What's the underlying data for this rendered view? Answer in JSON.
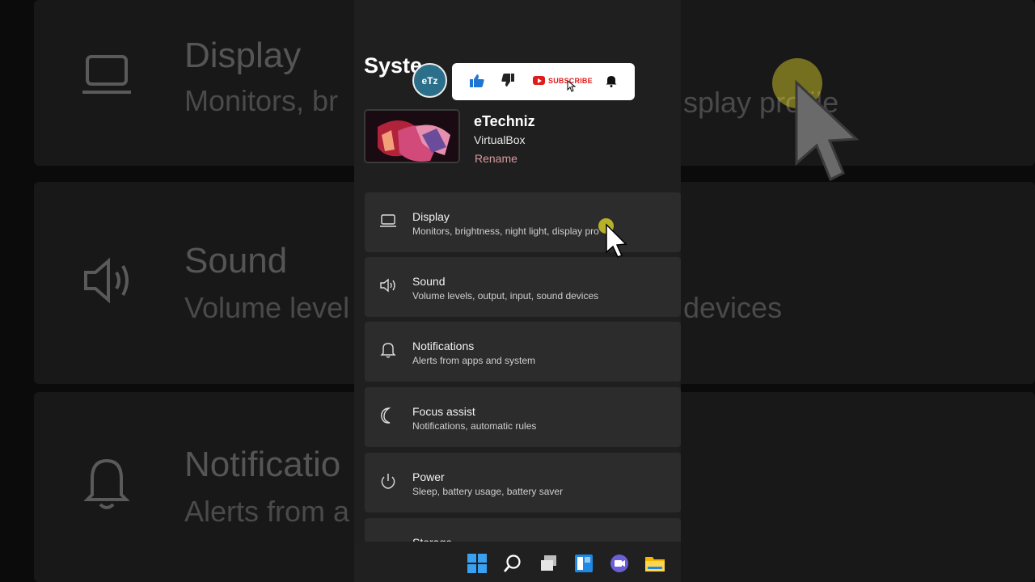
{
  "background": {
    "items": [
      {
        "title": "Display",
        "subtitle": "Monitors, br",
        "subtitle_right": "splay profile"
      },
      {
        "title": "Sound",
        "subtitle": "Volume level",
        "subtitle_right": "devices"
      },
      {
        "title": "Notificatio",
        "subtitle": "Alerts from a",
        "subtitle_right": ""
      }
    ]
  },
  "page": {
    "title": "Syste"
  },
  "overlay": {
    "logo_text": "eTz",
    "subscribe_label": "SUBSCRIBE"
  },
  "profile": {
    "name": "eTechniz",
    "device": "VirtualBox",
    "rename_label": "Rename"
  },
  "settings": [
    {
      "icon": "laptop-icon",
      "title": "Display",
      "desc": "Monitors, brightness, night light, display pro"
    },
    {
      "icon": "speaker-icon",
      "title": "Sound",
      "desc": "Volume levels, output, input, sound devices"
    },
    {
      "icon": "bell-icon",
      "title": "Notifications",
      "desc": "Alerts from apps and system"
    },
    {
      "icon": "moon-icon",
      "title": "Focus assist",
      "desc": "Notifications, automatic rules"
    },
    {
      "icon": "power-icon",
      "title": "Power",
      "desc": "Sleep, battery usage, battery saver"
    },
    {
      "icon": "storage-icon",
      "title": "Storage",
      "desc": ""
    }
  ],
  "taskbar": [
    "windows-start-icon",
    "search-icon",
    "task-view-icon",
    "widgets-icon",
    "teams-chat-icon",
    "file-explorer-icon"
  ],
  "colors": {
    "accent_rename": "#d89aa0",
    "card": "#2c2c2c",
    "panel": "#1f1f1f",
    "youtube_red": "#e01b1b"
  }
}
